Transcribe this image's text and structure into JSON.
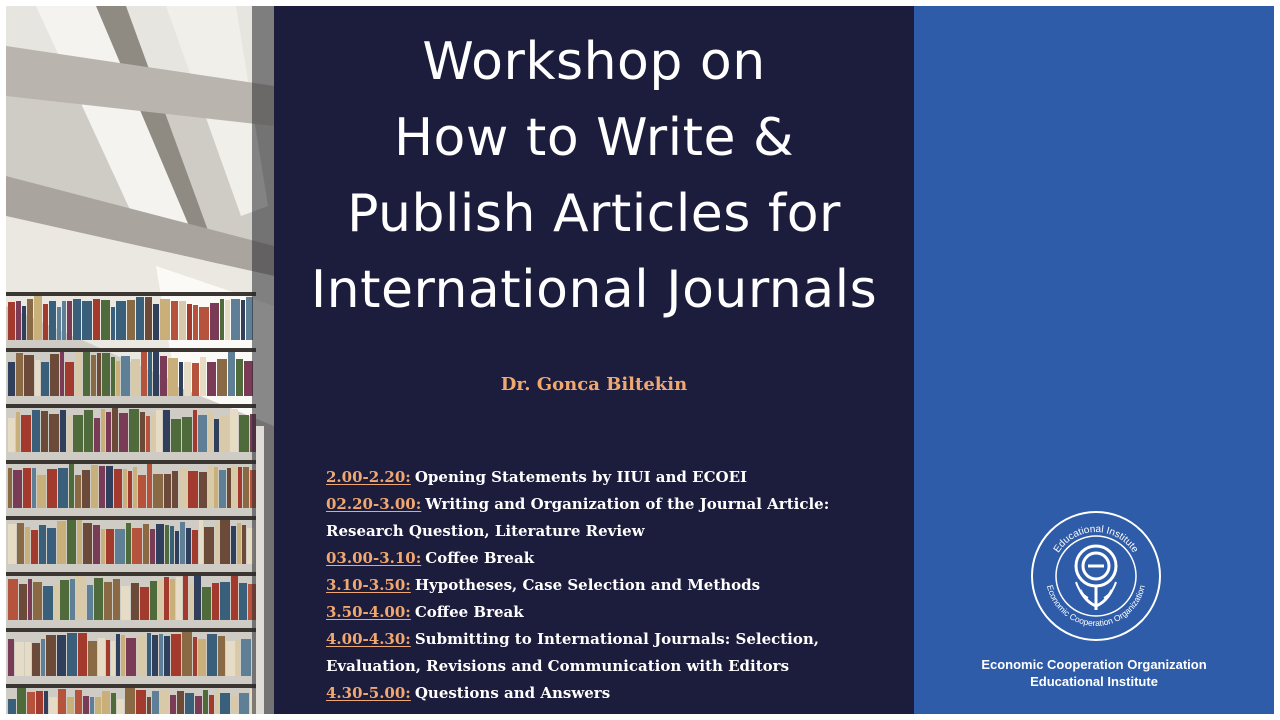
{
  "slide": {
    "title_lines": [
      "Workshop on",
      "How to Write &",
      "Publish Articles for",
      "International Journals"
    ],
    "author": "Dr. Gonca Biltekin",
    "schedule": [
      {
        "time": "2.00-2.20:",
        "text": "Opening Statements by IIUI and ECOEI",
        "cont": ""
      },
      {
        "time": "02.20-3.00:",
        "text": "Writing and Organization of the Journal Article:",
        "cont": "Research Question, Literature Review"
      },
      {
        "time": "03.00-3.10:",
        "text": "Coffee Break",
        "cont": ""
      },
      {
        "time": "3.10-3.50:",
        "text": "Hypotheses, Case Selection and Methods",
        "cont": ""
      },
      {
        "time": "3.50-4.00:",
        "text": "Coffee Break",
        "cont": ""
      },
      {
        "time": "4.00-4.30:",
        "text": "Submitting to International Journals: Selection,",
        "cont": "Evaluation, Revisions and Communication with Editors"
      },
      {
        "time": "4.30-5.00:",
        "text": "Questions and Answers",
        "cont": ""
      }
    ],
    "logo_ring_top": "Educational Institute",
    "logo_ring_bottom": "Economic Cooperation Organization",
    "org_line1": "Economic Cooperation Organization",
    "org_line2": "Educational Institute"
  },
  "colors": {
    "center_bg": "#1c1c3c",
    "right_bg": "#2e5ca8",
    "accent": "#f0a870"
  },
  "icons": [
    "library-bookshelf-photo",
    "eco-logo-icon"
  ]
}
